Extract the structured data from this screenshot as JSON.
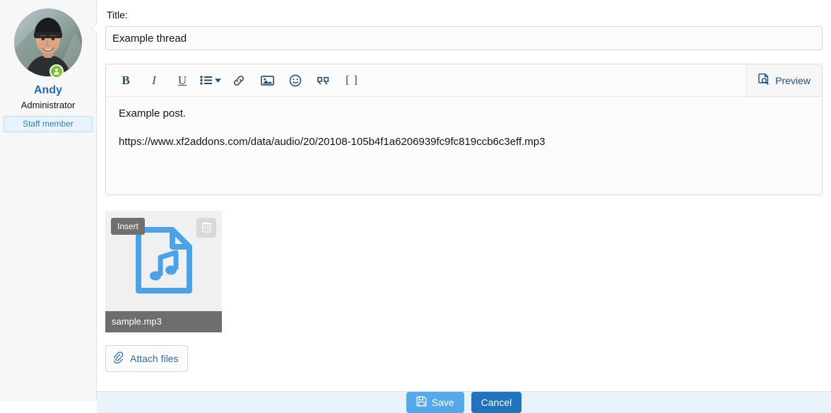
{
  "author": {
    "avatar_alt": "user-avatar",
    "online_indicator": "online-status-icon",
    "name": "Andy",
    "user_title": "Administrator",
    "banner": "Staff member"
  },
  "form": {
    "title_label": "Title:",
    "title_value": "Example thread",
    "title_placeholder": ""
  },
  "editor": {
    "toolbar": [
      {
        "name": "bold",
        "label": "B"
      },
      {
        "name": "italic",
        "label": "I"
      },
      {
        "name": "underline",
        "label": "U"
      },
      {
        "name": "list",
        "label": ""
      },
      {
        "name": "link",
        "label": ""
      },
      {
        "name": "image",
        "label": ""
      },
      {
        "name": "smilie",
        "label": ""
      },
      {
        "name": "quote",
        "label": ""
      },
      {
        "name": "bbcode",
        "label": "[ ]"
      }
    ],
    "preview_label": "Preview",
    "content": {
      "line1": "Example post.",
      "line2": "https://www.xf2addons.com/data/audio/20/20108-105b4f1a6206939fc9fc819ccb6c3eff.mp3"
    }
  },
  "attachments": {
    "items": [
      {
        "insert_label": "Insert",
        "delete_label": "delete-icon",
        "file_icon": "audio-file-icon",
        "filename": "sample.mp3"
      }
    ],
    "attach_files_label": "Attach files"
  },
  "footer": {
    "save_label": "Save",
    "cancel_label": "Cancel"
  },
  "colors": {
    "accent": "#1e6cb5",
    "save_button": "#54a9ec",
    "cancel_button": "#1f74bd",
    "footer_bg": "#e9f3fc",
    "banner_text": "#2c7fc4",
    "file_icon": "#4aa3e8",
    "online": "#7dc225"
  }
}
